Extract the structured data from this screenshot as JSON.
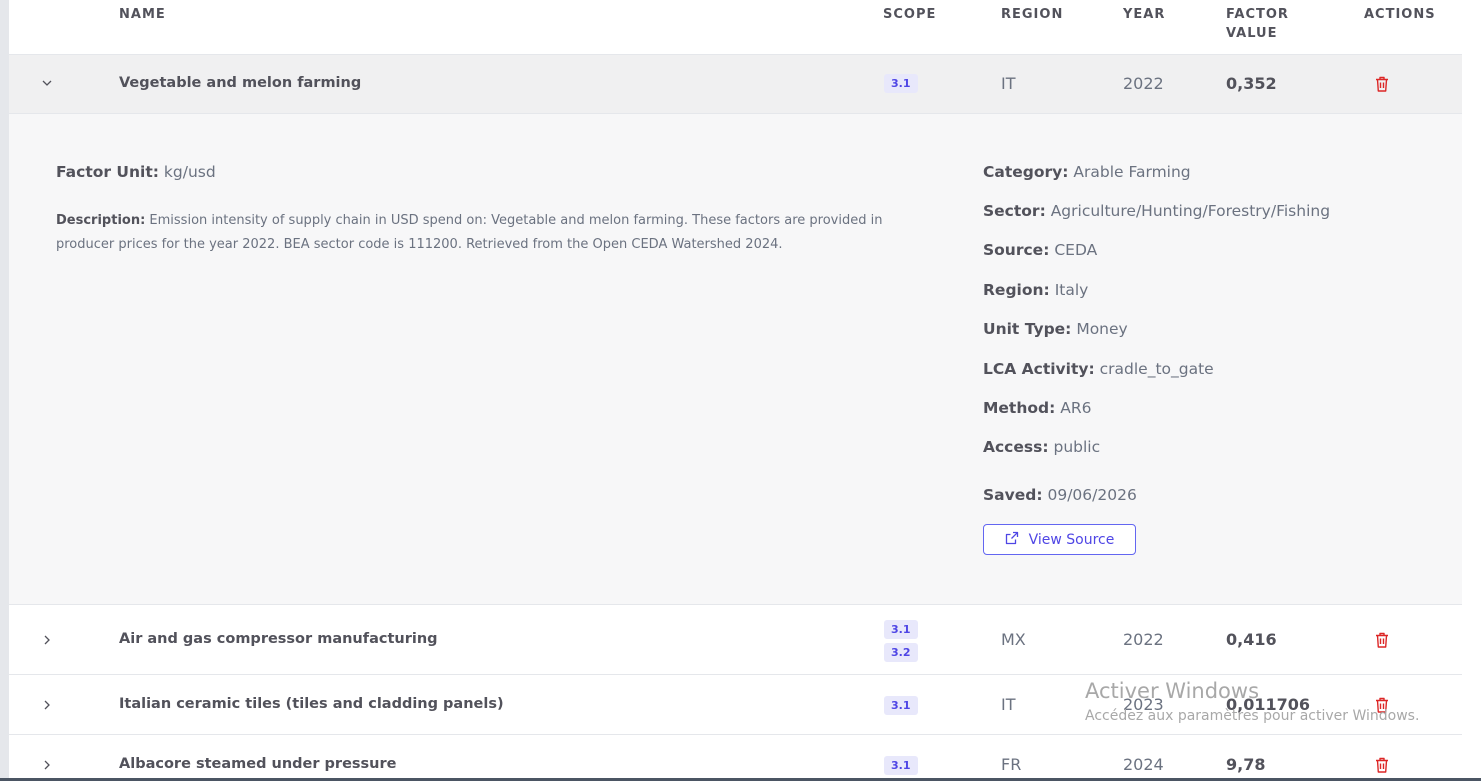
{
  "columns": {
    "name": "NAME",
    "scope": "SCOPE",
    "region": "REGION",
    "year": "YEAR",
    "factor_value_line1": "FACTOR",
    "factor_value_line2": "VALUE",
    "actions": "ACTIONS"
  },
  "rows": [
    {
      "name": "Vegetable and melon farming",
      "scopes": [
        "3.1"
      ],
      "region": "IT",
      "year": "2022",
      "factor_value": "0,352",
      "expanded": true
    },
    {
      "name": "Air and gas compressor manufacturing",
      "scopes": [
        "3.1",
        "3.2"
      ],
      "region": "MX",
      "year": "2022",
      "factor_value": "0,416",
      "expanded": false
    },
    {
      "name": "Italian ceramic tiles (tiles and cladding panels)",
      "scopes": [
        "3.1"
      ],
      "region": "IT",
      "year": "2023",
      "factor_value": "0,011706",
      "expanded": false
    },
    {
      "name": "Albacore steamed under pressure",
      "scopes": [
        "3.1"
      ],
      "region": "FR",
      "year": "2024",
      "factor_value": "9,78",
      "expanded": false
    }
  ],
  "detail": {
    "factor_unit_label": "Factor Unit:",
    "factor_unit": "kg/usd",
    "description_label": "Description:",
    "description": "Emission intensity of supply chain in USD spend on: Vegetable and melon farming. These factors are provided in producer prices for the year 2022. BEA sector code is 111200. Retrieved from the Open CEDA Watershed 2024.",
    "fields": [
      {
        "label": "Category:",
        "value": "Arable Farming"
      },
      {
        "label": "Sector:",
        "value": "Agriculture/Hunting/Forestry/Fishing"
      },
      {
        "label": "Source:",
        "value": "CEDA"
      },
      {
        "label": "Region:",
        "value": "Italy"
      },
      {
        "label": "Unit Type:",
        "value": "Money"
      },
      {
        "label": "LCA Activity:",
        "value": "cradle_to_gate"
      },
      {
        "label": "Method:",
        "value": "AR6"
      },
      {
        "label": "Access:",
        "value": "public"
      }
    ],
    "saved_label": "Saved:",
    "saved": "09/06/2026",
    "view_source_label": "View Source"
  },
  "watermark": {
    "line1": "Activer Windows",
    "line2": "Accédez aux paramètres pour activer Windows."
  },
  "icons": {
    "trash": "trash-icon",
    "chevron_down": "chevron-down-icon",
    "chevron_right": "chevron-right-icon",
    "external_link": "external-link-icon"
  },
  "colors": {
    "accent": "#4f46e5",
    "danger": "#dc2626",
    "scope_bg": "#e8e8fb"
  }
}
